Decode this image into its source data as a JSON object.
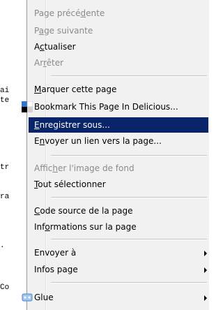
{
  "background_fragments": [
    "ai",
    "te",
    "tr",
    "ra",
    ".",
    "Co"
  ],
  "menu": {
    "items": [
      {
        "name": "menu-item-page-precedente",
        "parts": [
          "Page précé",
          "d",
          "ente"
        ],
        "disabled": true
      },
      {
        "name": "menu-item-page-suivante",
        "parts": [
          "P",
          "a",
          "ge suivante"
        ],
        "disabled": true
      },
      {
        "name": "menu-item-actualiser",
        "parts": [
          "A",
          "c",
          "tualiser"
        ],
        "disabled": false
      },
      {
        "name": "menu-item-arreter",
        "parts": [
          "Ar",
          "r",
          "êter"
        ],
        "disabled": true
      },
      {
        "name": "menu-item-marquer-cette-page",
        "parts": [
          "",
          "M",
          "arquer cette page"
        ],
        "disabled": false
      },
      {
        "name": "menu-item-bookmark-delicious",
        "parts": [
          "Bookmark This Page In Delicious...",
          "",
          ""
        ],
        "disabled": false
      },
      {
        "name": "menu-item-enregistrer-sous",
        "parts": [
          "",
          "E",
          "nregistrer sous..."
        ],
        "disabled": false,
        "selected": true
      },
      {
        "name": "menu-item-envoyer-lien",
        "parts": [
          "E",
          "n",
          "voyer un lien vers la page..."
        ],
        "disabled": false
      },
      {
        "name": "menu-item-afficher-image-fond",
        "parts": [
          "Affic",
          "h",
          "er l'image de fond"
        ],
        "disabled": true
      },
      {
        "name": "menu-item-tout-selectionner",
        "parts": [
          "",
          "T",
          "out sélectionner"
        ],
        "disabled": false
      },
      {
        "name": "menu-item-code-source",
        "parts": [
          "",
          "C",
          "ode source de la page"
        ],
        "disabled": false
      },
      {
        "name": "menu-item-informations-page",
        "parts": [
          "Inf",
          "o",
          "rmations sur la page"
        ],
        "disabled": false
      },
      {
        "name": "menu-item-envoyer-a",
        "parts": [
          "Envoyer à",
          "",
          ""
        ],
        "disabled": false,
        "submenu": true
      },
      {
        "name": "menu-item-infos-page",
        "parts": [
          "Infos page",
          "",
          ""
        ],
        "disabled": false,
        "submenu": true
      },
      {
        "name": "menu-item-glue",
        "parts": [
          "Glue",
          "",
          ""
        ],
        "disabled": false,
        "submenu": true
      }
    ]
  },
  "icons": {
    "delicious": "delicious-icon",
    "glue": "glue-icon"
  },
  "colors": {
    "selection": "#0a2469",
    "disabled_text": "#8a8a8a"
  }
}
